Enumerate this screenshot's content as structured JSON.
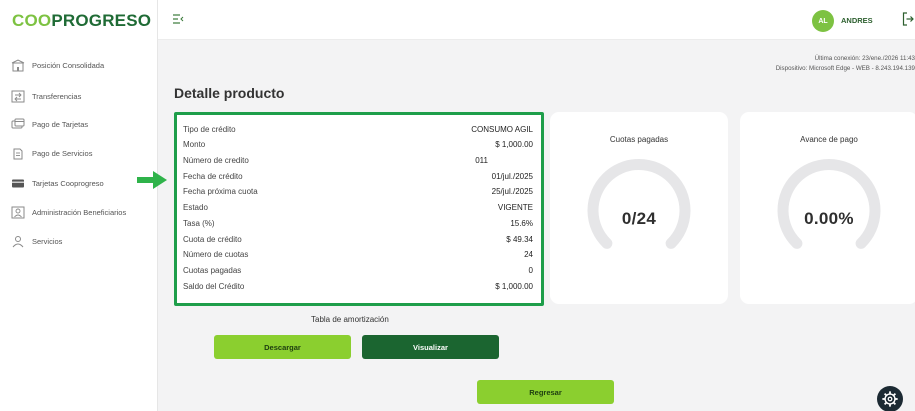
{
  "brand": {
    "part1": "COO",
    "part2": "PROGRESO"
  },
  "sidebar": {
    "items": [
      {
        "label": "Posición Consolidada",
        "icon": "building-icon"
      },
      {
        "label": "Transferencias",
        "icon": "transfer-icon"
      },
      {
        "label": "Pago de Tarjetas",
        "icon": "card-payment-icon"
      },
      {
        "label": "Pago de Servicios",
        "icon": "service-payment-icon"
      },
      {
        "label": "Tarjetas Cooprogreso",
        "icon": "credit-card-icon"
      },
      {
        "label": "Administración Beneficiarios",
        "icon": "beneficiaries-icon"
      },
      {
        "label": "Servicios",
        "icon": "services-icon"
      }
    ]
  },
  "topbar": {
    "menu_icon": "menu-collapse-icon",
    "avatar_initials": "AL",
    "username": "ANDRES",
    "logout_icon": "logout-icon"
  },
  "connection": {
    "last_login": "Última conexión: 23/ene./2026 11:43",
    "device": "Dispositivo: Microsoft Edge - WEB - 8.243.194.139"
  },
  "page": {
    "title": "Detalle producto"
  },
  "detail": {
    "rows": [
      {
        "label": "Tipo de crédito",
        "value": "CONSUMO AGIL"
      },
      {
        "label": "Monto",
        "value": "$ 1,000.00"
      },
      {
        "label": "Número de credito",
        "value": "011"
      },
      {
        "label": "Fecha de crédito",
        "value": "01/jul./2025"
      },
      {
        "label": "Fecha próxima cuota",
        "value": "25/jul./2025"
      },
      {
        "label": "Estado",
        "value": "VIGENTE"
      },
      {
        "label": "Tasa (%)",
        "value": "15.6%"
      },
      {
        "label": "Cuota de crédito",
        "value": "$ 49.34"
      },
      {
        "label": "Número de cuotas",
        "value": "24"
      },
      {
        "label": "Cuotas pagadas",
        "value": "0"
      },
      {
        "label": "Saldo del Crédito",
        "value": "$ 1,000.00"
      }
    ]
  },
  "stats": {
    "cuotas": {
      "title": "Cuotas pagadas",
      "value": "0/24",
      "progress": 0
    },
    "avance": {
      "title": "Avance de pago",
      "value": "0.00%",
      "progress": 0
    }
  },
  "amortization": {
    "label": "Tabla de amortización"
  },
  "buttons": {
    "download": "Descargar",
    "view": "Visualizar",
    "back": "Regresar"
  },
  "colors": {
    "brand_light": "#7dc242",
    "brand_dark": "#1f6b35",
    "highlight_border": "#1e9e4a",
    "button_light": "#8bcf2f",
    "button_dark": "#1b6530",
    "gauge_track": "#e6e6e8"
  }
}
